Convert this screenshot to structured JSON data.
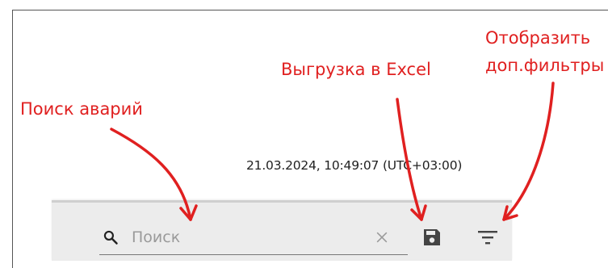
{
  "annotations": {
    "search": "Поиск аварий",
    "export_excel": "Выгрузка в Excel",
    "show_filters_line1": "Отобразить",
    "show_filters_line2": "доп.фильтры"
  },
  "status": {
    "timestamp": "21.03.2024, 10:49:07 (UTC+03:00)"
  },
  "toolbar": {
    "search_placeholder": "Поиск",
    "search_value": ""
  },
  "colors": {
    "annotation": "#e02020",
    "toolbar_bg": "#ececec",
    "icon": "#444444"
  },
  "icons": {
    "search": "search-icon",
    "clear": "close-icon",
    "export": "save-icon",
    "filter": "filter-icon"
  }
}
